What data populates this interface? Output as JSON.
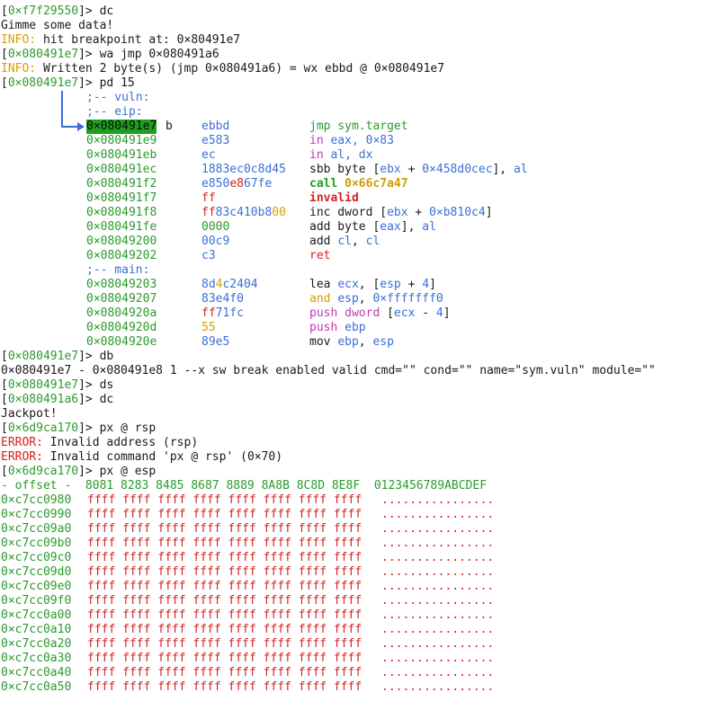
{
  "colors": {
    "address": "#2c9a2c",
    "info": "#d9a000",
    "error": "#d62222",
    "comment": "#3b6fd6",
    "highlight": "#1ea01e"
  },
  "top_lines": [
    {
      "kind": "prompt",
      "addr": "0×f7f29550",
      "cmd": "dc"
    },
    {
      "kind": "text",
      "text": "Gimme some data!"
    },
    {
      "kind": "info",
      "label": "INFO:",
      "text": " hit breakpoint at: 0×80491e7"
    },
    {
      "kind": "prompt",
      "addr": "0×080491e7",
      "cmd": "wa jmp 0×080491a6"
    },
    {
      "kind": "info",
      "label": "INFO:",
      "text": " Written 2 byte(s) (jmp 0×080491a6) = wx ebbd @ 0×080491e7"
    },
    {
      "kind": "prompt",
      "addr": "0×080491e7",
      "cmd": "pd 15"
    }
  ],
  "disasm": [
    {
      "type": "comment",
      "text": ";-- vuln:"
    },
    {
      "type": "comment",
      "text": ";-- eip:"
    },
    {
      "type": "ins",
      "addr": "0×080491e7",
      "highlight": true,
      "flag": "b",
      "bytes": [
        {
          "t": "ebbd",
          "c": "#3b6fd6"
        }
      ],
      "instr": [
        {
          "t": "jmp sym.target",
          "c": "#2c9a2c"
        }
      ]
    },
    {
      "type": "ins",
      "addr": "0×080491e9",
      "bytes": [
        {
          "t": "e583",
          "c": "#3b6fd6"
        }
      ],
      "instr": [
        {
          "t": "in ",
          "c": "#c23bb0"
        },
        {
          "t": "eax",
          "c": "#3b6fd6"
        },
        {
          "t": ", 0×83",
          "c": "#3b6fd6"
        }
      ]
    },
    {
      "type": "ins",
      "addr": "0×080491eb",
      "bytes": [
        {
          "t": "ec",
          "c": "#3b6fd6"
        }
      ],
      "instr": [
        {
          "t": "in ",
          "c": "#c23bb0"
        },
        {
          "t": "al",
          "c": "#3b6fd6"
        },
        {
          "t": ", dx",
          "c": "#3b6fd6"
        }
      ]
    },
    {
      "type": "ins",
      "addr": "0×080491ec",
      "bytes": [
        {
          "t": "1883ec0c8d45",
          "c": "#3b6fd6"
        }
      ],
      "instr": [
        {
          "t": "sbb byte [",
          "c": "#1a1a1a"
        },
        {
          "t": "ebx",
          "c": "#3b6fd6"
        },
        {
          "t": " + ",
          "c": "#1a1a1a"
        },
        {
          "t": "0×458d0cec",
          "c": "#3b6fd6"
        },
        {
          "t": "], ",
          "c": "#1a1a1a"
        },
        {
          "t": "al",
          "c": "#3b6fd6"
        }
      ]
    },
    {
      "type": "ins",
      "addr": "0×080491f2",
      "bytes": [
        {
          "t": "e850",
          "c": "#3b6fd6"
        },
        {
          "t": "e8",
          "c": "#d62222"
        },
        {
          "t": "67fe",
          "c": "#3b6fd6"
        }
      ],
      "instr": [
        {
          "t": "call ",
          "c": "#1ea01e",
          "b": true
        },
        {
          "t": "0×66c7a47",
          "c": "#c9a000",
          "b": true
        }
      ]
    },
    {
      "type": "ins",
      "addr": "0×080491f7",
      "bytes": [
        {
          "t": "ff",
          "c": "#d62222"
        }
      ],
      "instr": [
        {
          "t": "invalid",
          "c": "#d62222",
          "b": true
        }
      ]
    },
    {
      "type": "ins",
      "addr": "0×080491f8",
      "bytes": [
        {
          "t": "ff",
          "c": "#d62222"
        },
        {
          "t": "83c410b8",
          "c": "#3b6fd6"
        },
        {
          "t": "00",
          "c": "#d9a000"
        }
      ],
      "instr": [
        {
          "t": "inc dword [",
          "c": "#1a1a1a"
        },
        {
          "t": "ebx",
          "c": "#3b6fd6"
        },
        {
          "t": " + ",
          "c": "#1a1a1a"
        },
        {
          "t": "0×b810c4",
          "c": "#3b6fd6"
        },
        {
          "t": "]",
          "c": "#1a1a1a"
        }
      ]
    },
    {
      "type": "ins",
      "addr": "0×080491fe",
      "bytes": [
        {
          "t": "0000",
          "c": "#2c9a2c"
        }
      ],
      "instr": [
        {
          "t": "add byte [",
          "c": "#1a1a1a"
        },
        {
          "t": "eax",
          "c": "#3b6fd6"
        },
        {
          "t": "], ",
          "c": "#1a1a1a"
        },
        {
          "t": "al",
          "c": "#3b6fd6"
        }
      ]
    },
    {
      "type": "ins",
      "addr": "0×08049200",
      "bytes": [
        {
          "t": "00c9",
          "c": "#3b6fd6"
        }
      ],
      "instr": [
        {
          "t": "add ",
          "c": "#1a1a1a"
        },
        {
          "t": "cl",
          "c": "#3b6fd6"
        },
        {
          "t": ", ",
          "c": "#1a1a1a"
        },
        {
          "t": "cl",
          "c": "#3b6fd6"
        }
      ]
    },
    {
      "type": "ins",
      "addr": "0×08049202",
      "bytes": [
        {
          "t": "c3",
          "c": "#3b6fd6"
        }
      ],
      "instr": [
        {
          "t": "ret",
          "c": "#d62222"
        }
      ]
    },
    {
      "type": "comment",
      "text": ";-- main:"
    },
    {
      "type": "ins",
      "addr": "0×08049203",
      "bytes": [
        {
          "t": "8d",
          "c": "#3b6fd6"
        },
        {
          "t": "4",
          "c": "#d9a000"
        },
        {
          "t": "c2404",
          "c": "#3b6fd6"
        }
      ],
      "instr": [
        {
          "t": "lea ",
          "c": "#1a1a1a"
        },
        {
          "t": "ecx",
          "c": "#3b6fd6"
        },
        {
          "t": ", [",
          "c": "#1a1a1a"
        },
        {
          "t": "esp",
          "c": "#3b6fd6"
        },
        {
          "t": " + ",
          "c": "#1a1a1a"
        },
        {
          "t": "4",
          "c": "#3b6fd6"
        },
        {
          "t": "]",
          "c": "#1a1a1a"
        }
      ]
    },
    {
      "type": "ins",
      "addr": "0×08049207",
      "bytes": [
        {
          "t": "83e4f0",
          "c": "#3b6fd6"
        }
      ],
      "instr": [
        {
          "t": "and ",
          "c": "#d9a000"
        },
        {
          "t": "esp",
          "c": "#3b6fd6"
        },
        {
          "t": ", ",
          "c": "#1a1a1a"
        },
        {
          "t": "0×fffffff0",
          "c": "#3b6fd6"
        }
      ]
    },
    {
      "type": "ins",
      "addr": "0×0804920a",
      "bytes": [
        {
          "t": "ff",
          "c": "#d62222"
        },
        {
          "t": "71fc",
          "c": "#3b6fd6"
        }
      ],
      "instr": [
        {
          "t": "push dword ",
          "c": "#c23bb0"
        },
        {
          "t": "[",
          "c": "#1a1a1a"
        },
        {
          "t": "ecx",
          "c": "#3b6fd6"
        },
        {
          "t": " - ",
          "c": "#1a1a1a"
        },
        {
          "t": "4",
          "c": "#3b6fd6"
        },
        {
          "t": "]",
          "c": "#1a1a1a"
        }
      ]
    },
    {
      "type": "ins",
      "addr": "0×0804920d",
      "bytes": [
        {
          "t": "55",
          "c": "#d9a000"
        }
      ],
      "instr": [
        {
          "t": "push ",
          "c": "#c23bb0"
        },
        {
          "t": "ebp",
          "c": "#3b6fd6"
        }
      ]
    },
    {
      "type": "ins",
      "addr": "0×0804920e",
      "bytes": [
        {
          "t": "89e5",
          "c": "#3b6fd6"
        }
      ],
      "instr": [
        {
          "t": "mov ",
          "c": "#1a1a1a"
        },
        {
          "t": "ebp",
          "c": "#3b6fd6"
        },
        {
          "t": ", ",
          "c": "#1a1a1a"
        },
        {
          "t": "esp",
          "c": "#3b6fd6"
        }
      ]
    }
  ],
  "mid_lines": [
    {
      "kind": "prompt",
      "addr": "0×080491e7",
      "cmd": "db"
    },
    {
      "kind": "text",
      "text": "0×080491e7 - 0×080491e8 1 --x sw break enabled valid cmd=\"\" cond=\"\" name=\"sym.vuln\" module=\"\""
    },
    {
      "kind": "prompt",
      "addr": "0×080491e7",
      "cmd": "ds"
    },
    {
      "kind": "prompt",
      "addr": "0×080491a6",
      "cmd": "dc"
    },
    {
      "kind": "text",
      "text": "Jackpot!"
    },
    {
      "kind": "prompt",
      "addr": "0×6d9ca170",
      "cmd": "px @ rsp"
    },
    {
      "kind": "error",
      "label": "ERROR:",
      "text": " Invalid address (rsp)"
    },
    {
      "kind": "error",
      "label": "ERROR:",
      "text": " Invalid command 'px @ rsp' (0×70)"
    },
    {
      "kind": "prompt",
      "addr": "0×6d9ca170",
      "cmd": "px @ esp"
    }
  ],
  "hexdump": {
    "header": "- offset -  8081 8283 8485 8687 8889 8A8B 8C8D 8E8F  0123456789ABCDEF",
    "row_values": "ffff ffff ffff ffff ffff ffff ffff ffff",
    "row_ascii": "................",
    "offsets": [
      "0×c7cc0980",
      "0×c7cc0990",
      "0×c7cc09a0",
      "0×c7cc09b0",
      "0×c7cc09c0",
      "0×c7cc09d0",
      "0×c7cc09e0",
      "0×c7cc09f0",
      "0×c7cc0a00",
      "0×c7cc0a10",
      "0×c7cc0a20",
      "0×c7cc0a30",
      "0×c7cc0a40",
      "0×c7cc0a50"
    ]
  }
}
